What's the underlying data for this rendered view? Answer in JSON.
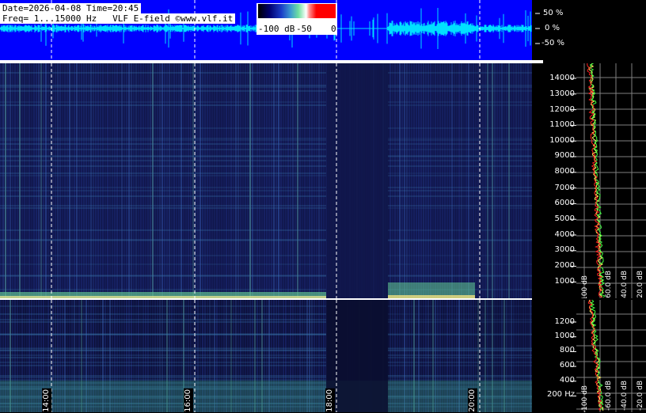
{
  "header": {
    "line1": "Date=2026-04-08 Time=20:45",
    "line2": "Freq= 1...15000 Hz   VLF E-field ©www.vlf.it"
  },
  "colorbar": {
    "labels": [
      "-100 dB",
      "-50",
      "0"
    ],
    "colors": [
      "#000000",
      "#000070",
      "#1a3cc8",
      "#3c9ad0",
      "#6ee0a0",
      "#ffffff",
      "#ff0000"
    ]
  },
  "waveform_scale": [
    "50 %",
    "0 %",
    "-50 %"
  ],
  "freq_axis_top": [
    "14000",
    "13000",
    "12000",
    "11000",
    "10000",
    "9000",
    "8000",
    "7000",
    "6000",
    "5000",
    "4000",
    "3000",
    "2000",
    "1000"
  ],
  "freq_axis_bottom": [
    "1200",
    "1000",
    "800",
    "600",
    "400",
    "200 Hz"
  ],
  "time_labels": [
    "14:00",
    "16:00",
    "18:00",
    "20:00"
  ],
  "profile_labels": [
    "-100 dB",
    "-60.0 dB",
    "-40.0 dB",
    "-20.0 dB"
  ],
  "colors": {
    "waveform_bg": "#0000ff",
    "waveform_trace": "#00e0ff",
    "spectrogram_bg": "#10164a",
    "profile_grid": "#808080",
    "profile_trace_red": "#ff2020",
    "profile_trace_green": "#40ff40",
    "profile_trace_yellow": "#ffff60"
  }
}
